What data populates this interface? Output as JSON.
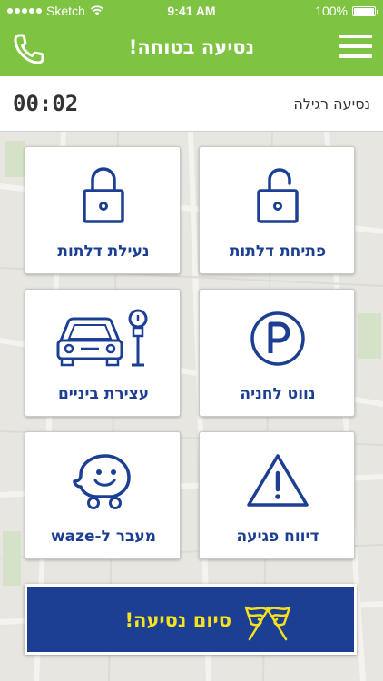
{
  "status_bar": {
    "carrier": "Sketch",
    "time": "9:41 AM",
    "battery": "100%"
  },
  "nav": {
    "title": "נסיעה בטוחה!",
    "left_icon": "phone-icon",
    "right_icon": "hamburger-menu-icon"
  },
  "timer": {
    "value": "00:02",
    "ride_type": "נסיעה רגילה"
  },
  "tiles": [
    {
      "label": "פתיחת דלתות",
      "icon": "unlocked-padlock-icon"
    },
    {
      "label": "נעילת דלתות",
      "icon": "locked-padlock-icon"
    },
    {
      "label": "נווט לחניה",
      "icon": "parking-icon"
    },
    {
      "label": "עצירת ביניים",
      "icon": "car-parking-meter-icon"
    },
    {
      "label": "דיווח פגיעה",
      "icon": "warning-triangle-icon"
    },
    {
      "label": "מעבר ל-waze",
      "icon": "waze-icon"
    }
  ],
  "end_button": {
    "label": "סיום נסיעה!",
    "icon": "checkered-flags-icon"
  },
  "colors": {
    "brand_green": "#7fc343",
    "brand_blue": "#1c3f94",
    "accent_yellow": "#f6e21d",
    "map_background": "#e7e6e0"
  }
}
